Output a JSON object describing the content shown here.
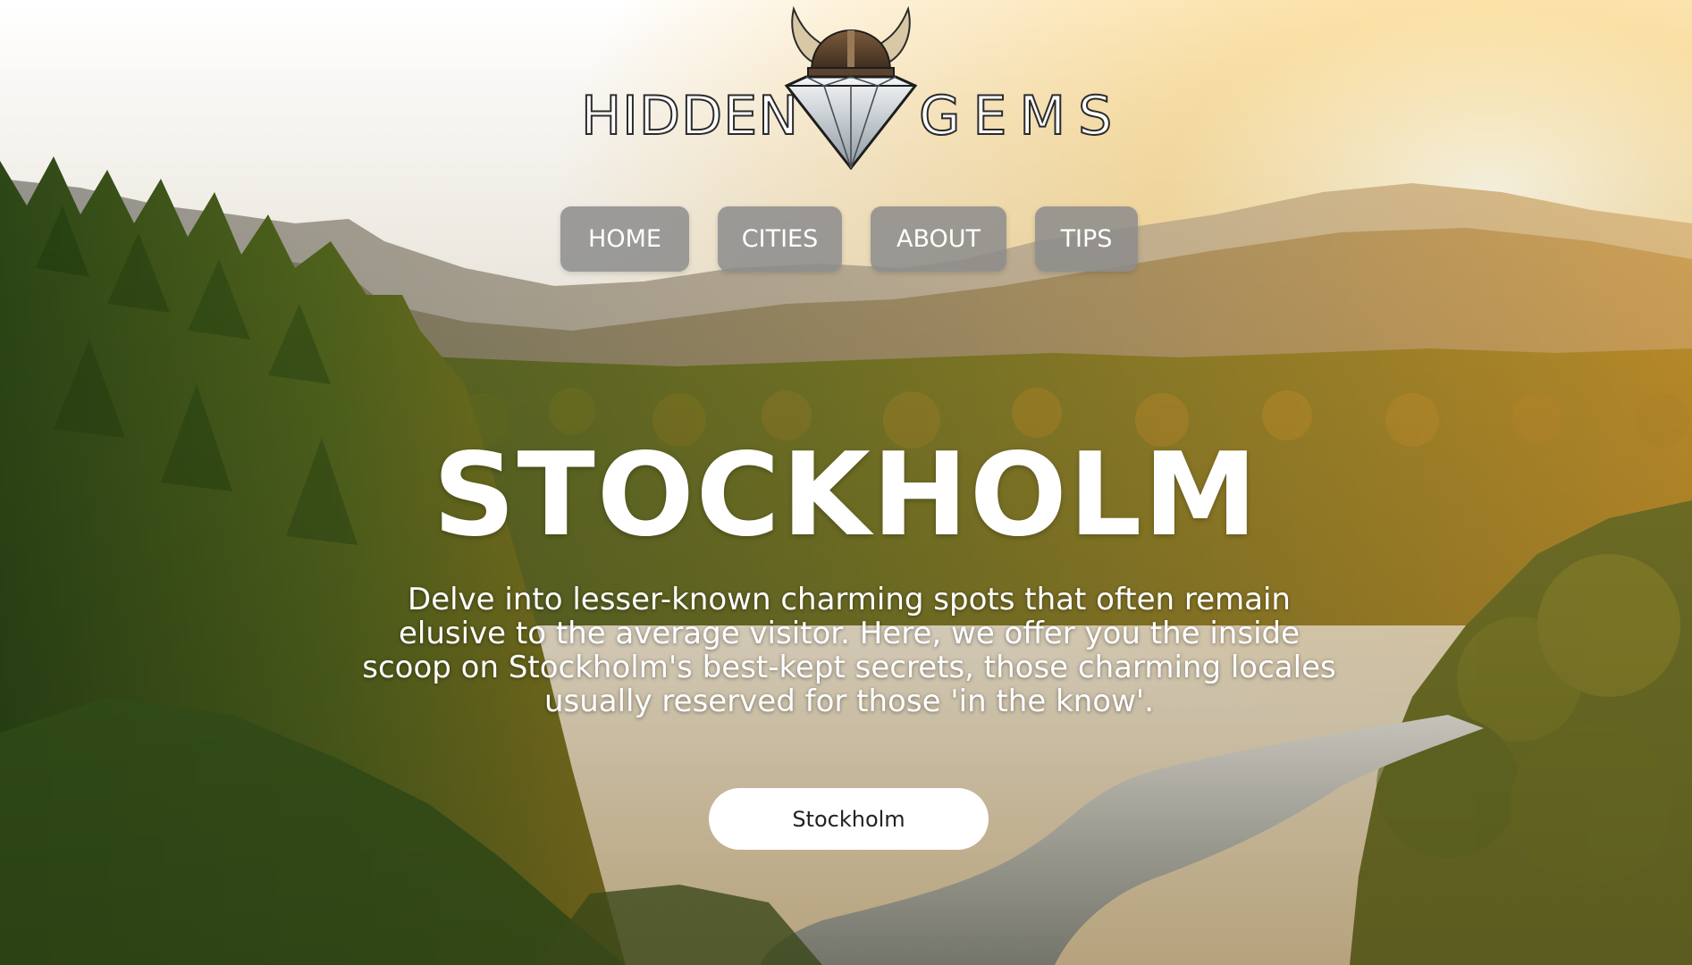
{
  "logo": {
    "word_left": "HIDDEN",
    "word_right": "GEMS",
    "emblem": "viking-helmet-diamond-icon"
  },
  "nav": {
    "items": [
      {
        "label": "HOME"
      },
      {
        "label": "CITIES"
      },
      {
        "label": "ABOUT"
      },
      {
        "label": "TIPS"
      }
    ]
  },
  "hero": {
    "title": "STOCKHOLM",
    "description": "Delve into lesser-known charming spots that often remain elusive to the average visitor. Here, we offer you the inside scoop on Stockholm's best-kept secrets, those charming locales usually reserved for those 'in the know'.",
    "cta_label": "Stockholm"
  },
  "colors": {
    "nav_button_bg": "#8c8c8c",
    "cta_bg": "#ffffff",
    "title_text": "#ffffff",
    "sunlight": "#f6c667"
  }
}
